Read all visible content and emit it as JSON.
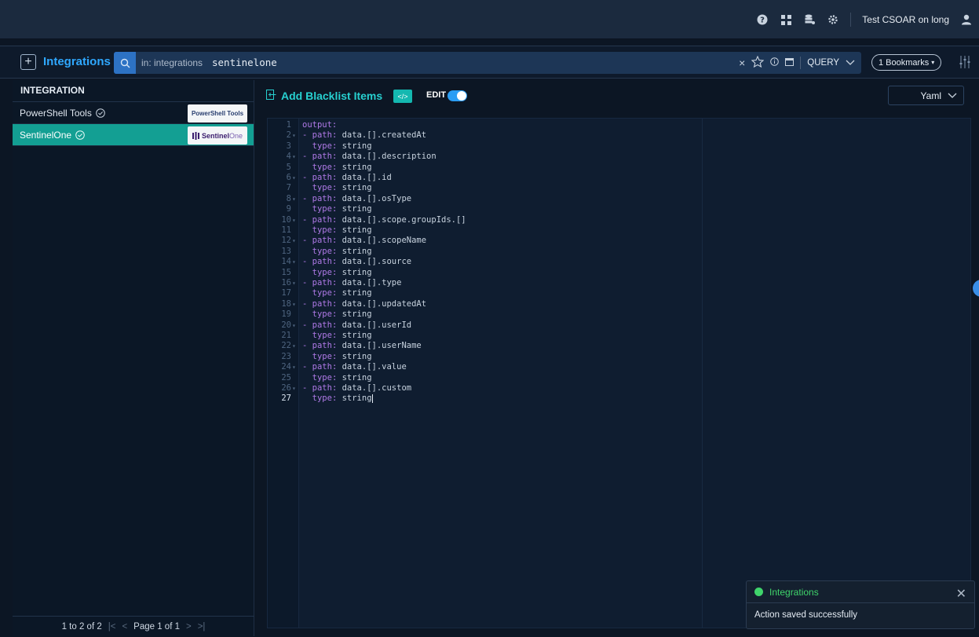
{
  "topbar": {
    "user_name": "Test CSOAR on long",
    "icons": [
      "help-icon",
      "grid-icon",
      "database-icon",
      "settings-icon",
      "user-icon"
    ]
  },
  "search_bar": {
    "title": "Integrations",
    "scope": "in: integrations",
    "query": "sentinelone",
    "query_mode": "QUERY",
    "bookmarks": "1 Bookmarks"
  },
  "sidebar": {
    "header": "INTEGRATION",
    "items": [
      {
        "label": "PowerShell Tools",
        "logo_text": "PowerShell Tools",
        "active": false
      },
      {
        "label": "SentinelOne",
        "logo_text_bold": "Sentinel",
        "logo_text_thin": "One",
        "active": true
      }
    ],
    "pager": {
      "range": "1 to 2 of 2",
      "page": "Page 1 of 1"
    }
  },
  "main": {
    "action_title": "Add Blacklist Items",
    "code_badge": "</>",
    "edit_label": "EDIT",
    "format": "Yaml"
  },
  "editor": {
    "current_line": 27,
    "lines": [
      {
        "n": "1",
        "fold": false,
        "key": "output",
        "dash": false,
        "indent": false,
        "val": ""
      },
      {
        "n": "2",
        "fold": true,
        "key": "path",
        "dash": true,
        "indent": false,
        "val": "data.[].createdAt"
      },
      {
        "n": "3",
        "fold": false,
        "key": "type",
        "dash": false,
        "indent": true,
        "val": "string"
      },
      {
        "n": "4",
        "fold": true,
        "key": "path",
        "dash": true,
        "indent": false,
        "val": "data.[].description"
      },
      {
        "n": "5",
        "fold": false,
        "key": "type",
        "dash": false,
        "indent": true,
        "val": "string"
      },
      {
        "n": "6",
        "fold": true,
        "key": "path",
        "dash": true,
        "indent": false,
        "val": "data.[].id"
      },
      {
        "n": "7",
        "fold": false,
        "key": "type",
        "dash": false,
        "indent": true,
        "val": "string"
      },
      {
        "n": "8",
        "fold": true,
        "key": "path",
        "dash": true,
        "indent": false,
        "val": "data.[].osType"
      },
      {
        "n": "9",
        "fold": false,
        "key": "type",
        "dash": false,
        "indent": true,
        "val": "string"
      },
      {
        "n": "10",
        "fold": true,
        "key": "path",
        "dash": true,
        "indent": false,
        "val": "data.[].scope.groupIds.[]"
      },
      {
        "n": "11",
        "fold": false,
        "key": "type",
        "dash": false,
        "indent": true,
        "val": "string"
      },
      {
        "n": "12",
        "fold": true,
        "key": "path",
        "dash": true,
        "indent": false,
        "val": "data.[].scopeName"
      },
      {
        "n": "13",
        "fold": false,
        "key": "type",
        "dash": false,
        "indent": true,
        "val": "string"
      },
      {
        "n": "14",
        "fold": true,
        "key": "path",
        "dash": true,
        "indent": false,
        "val": "data.[].source"
      },
      {
        "n": "15",
        "fold": false,
        "key": "type",
        "dash": false,
        "indent": true,
        "val": "string"
      },
      {
        "n": "16",
        "fold": true,
        "key": "path",
        "dash": true,
        "indent": false,
        "val": "data.[].type"
      },
      {
        "n": "17",
        "fold": false,
        "key": "type",
        "dash": false,
        "indent": true,
        "val": "string"
      },
      {
        "n": "18",
        "fold": true,
        "key": "path",
        "dash": true,
        "indent": false,
        "val": "data.[].updatedAt"
      },
      {
        "n": "19",
        "fold": false,
        "key": "type",
        "dash": false,
        "indent": true,
        "val": "string"
      },
      {
        "n": "20",
        "fold": true,
        "key": "path",
        "dash": true,
        "indent": false,
        "val": "data.[].userId"
      },
      {
        "n": "21",
        "fold": false,
        "key": "type",
        "dash": false,
        "indent": true,
        "val": "string"
      },
      {
        "n": "22",
        "fold": true,
        "key": "path",
        "dash": true,
        "indent": false,
        "val": "data.[].userName"
      },
      {
        "n": "23",
        "fold": false,
        "key": "type",
        "dash": false,
        "indent": true,
        "val": "string"
      },
      {
        "n": "24",
        "fold": true,
        "key": "path",
        "dash": true,
        "indent": false,
        "val": "data.[].value"
      },
      {
        "n": "25",
        "fold": false,
        "key": "type",
        "dash": false,
        "indent": true,
        "val": "string"
      },
      {
        "n": "26",
        "fold": true,
        "key": "path",
        "dash": true,
        "indent": false,
        "val": "data.[].custom"
      },
      {
        "n": "27",
        "fold": false,
        "key": "type",
        "dash": false,
        "indent": true,
        "val": "string"
      }
    ]
  },
  "toast": {
    "title": "Integrations",
    "message": "Action saved successfully"
  }
}
